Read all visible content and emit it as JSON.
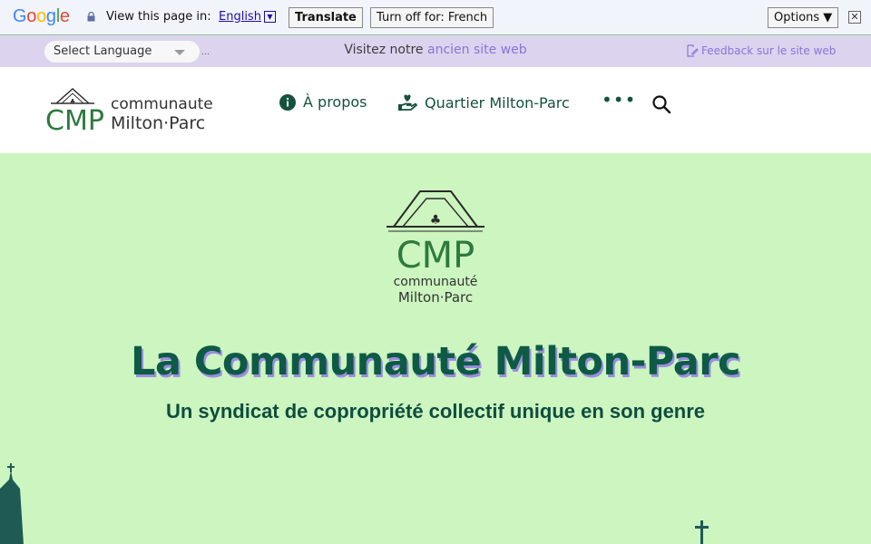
{
  "translate_bar": {
    "logo": {
      "G": "G",
      "o1": "o",
      "o2": "o",
      "g": "g",
      "l": "l",
      "e": "e"
    },
    "prompt": "View this page in:",
    "language": "English",
    "translate_label": "Translate",
    "turn_off_label": "Turn off for: French",
    "options_label": "Options ▼",
    "close_glyph": "✕"
  },
  "util_bar": {
    "language_select": "Select Language",
    "dots": "…",
    "visit_prefix": "Visitez notre ",
    "visit_link": "ancien site web",
    "feedback": "Feedback sur le site web"
  },
  "header": {
    "logo_line1": "communaute",
    "logo_line2": "Milton·Parc",
    "nav": [
      {
        "label": "À propos",
        "icon": "info-icon"
      },
      {
        "label": "Quartier Milton-Parc",
        "icon": "hand-heart-icon"
      }
    ],
    "more_glyph": "•••",
    "search_icon": "search-icon"
  },
  "hero": {
    "logo_line1": "communauté",
    "logo_line2": "Milton·Parc",
    "title": "La Communauté Milton-Parc",
    "subtitle": "Un syndicat de copropriété collectif unique en son genre"
  },
  "colors": {
    "hero_bg": "#ccf5c0",
    "brand_green": "#14523d",
    "accent_purple": "#8a75d8",
    "util_bar_bg": "#dcd3ee"
  }
}
